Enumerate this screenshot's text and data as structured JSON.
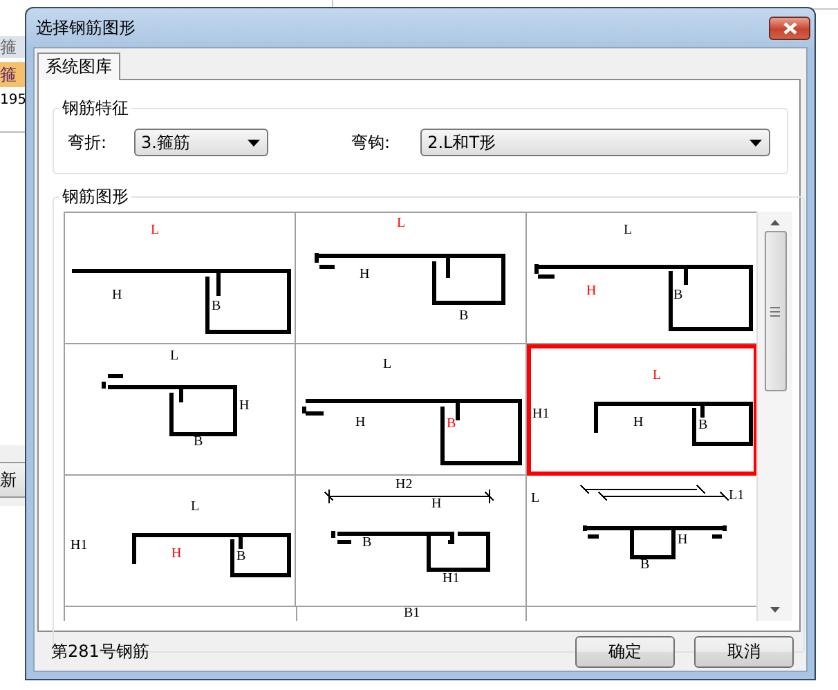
{
  "background_window": {
    "header_cell": "箍",
    "highlighted_cell": "箍",
    "value_cell": "195",
    "button": "新"
  },
  "dialog": {
    "title": "选择钢筋图形",
    "tabs": [
      {
        "label": "系统图库",
        "selected": true
      }
    ],
    "features": {
      "title": "钢筋特征",
      "bend_label": "弯折:",
      "bend_value": "3.箍筋",
      "hook_label": "弯钩:",
      "hook_value": "2.L和T形"
    },
    "gallery": {
      "title": "钢筋图形",
      "cells": [
        {
          "kind": "long-box",
          "selected": false,
          "labels": [
            {
              "text": "L",
              "color": "#ff0000"
            },
            {
              "text": "H",
              "color": "#000000"
            },
            {
              "text": "B",
              "color": "#000000"
            }
          ]
        },
        {
          "kind": "hooked-box",
          "selected": false,
          "labels": [
            {
              "text": "L",
              "color": "#ff0000"
            },
            {
              "text": "H",
              "color": "#000000"
            },
            {
              "text": "B",
              "color": "#000000"
            }
          ]
        },
        {
          "kind": "hooked-long-box",
          "selected": false,
          "labels": [
            {
              "text": "L",
              "color": "#000000"
            },
            {
              "text": "H",
              "color": "#ff0000"
            },
            {
              "text": "B",
              "color": "#000000"
            }
          ]
        },
        {
          "kind": "raised-hook-box",
          "selected": false,
          "labels": [
            {
              "text": "L",
              "color": "#000000"
            },
            {
              "text": "H",
              "color": "#000000"
            },
            {
              "text": "B",
              "color": "#000000"
            }
          ]
        },
        {
          "kind": "low-hook-box",
          "selected": false,
          "labels": [
            {
              "text": "L",
              "color": "#000000"
            },
            {
              "text": "H",
              "color": "#000000"
            },
            {
              "text": "B",
              "color": "#ff0000"
            }
          ]
        },
        {
          "kind": "bent-box",
          "selected": true,
          "labels": [
            {
              "text": "L",
              "color": "#ff0000"
            },
            {
              "text": "H1",
              "color": "#000000"
            },
            {
              "text": "H",
              "color": "#000000"
            },
            {
              "text": "B",
              "color": "#000000"
            }
          ]
        },
        {
          "kind": "bent-box",
          "selected": false,
          "labels": [
            {
              "text": "L",
              "color": "#000000"
            },
            {
              "text": "H1",
              "color": "#000000"
            },
            {
              "text": "H",
              "color": "#ff0000"
            },
            {
              "text": "B",
              "color": "#000000"
            }
          ]
        },
        {
          "kind": "dimensioned-box",
          "selected": false,
          "labels": [
            {
              "text": "H2",
              "color": "#000000"
            },
            {
              "text": "H",
              "color": "#000000"
            },
            {
              "text": "B",
              "color": "#000000"
            },
            {
              "text": "H1",
              "color": "#000000"
            }
          ]
        },
        {
          "kind": "t-box",
          "selected": false,
          "labels": [
            {
              "text": "L",
              "color": "#000000"
            },
            {
              "text": "L1",
              "color": "#000000"
            },
            {
              "text": "H",
              "color": "#000000"
            },
            {
              "text": "B",
              "color": "#000000"
            }
          ]
        },
        {
          "kind": "partial",
          "selected": false,
          "labels": [
            {
              "text": "B1",
              "color": "#000000"
            }
          ]
        }
      ]
    },
    "status": "第281号钢筋",
    "buttons": [
      "确定",
      "取消"
    ]
  }
}
